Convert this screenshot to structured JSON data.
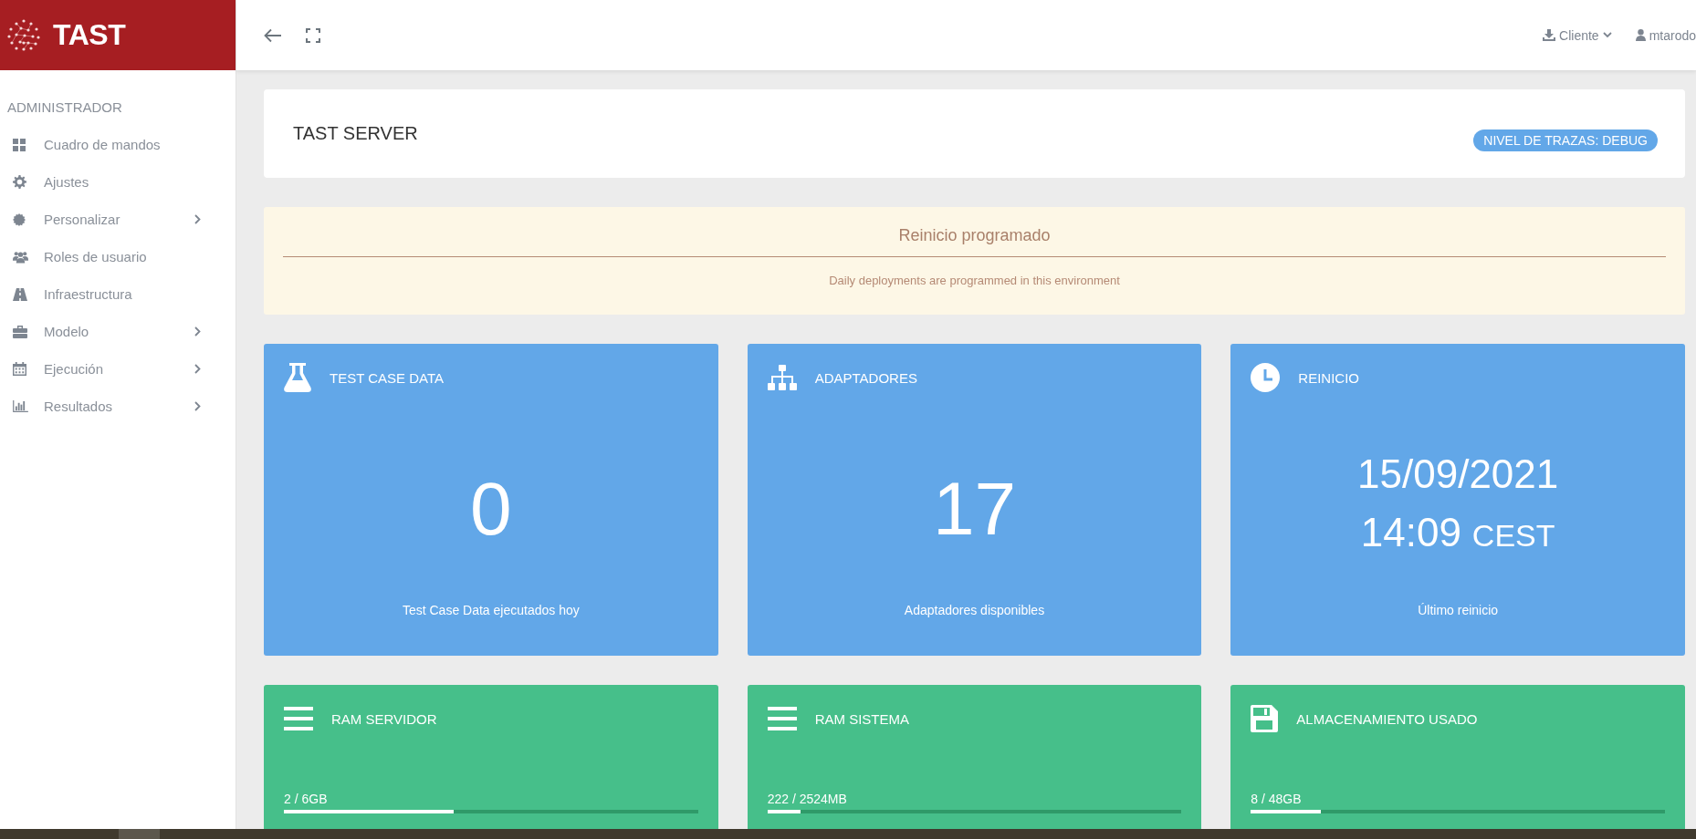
{
  "brand": {
    "name": "TAST"
  },
  "topbar": {
    "client_menu": "Cliente",
    "user_menu": "mtarodo"
  },
  "sidebar": {
    "section": "ADMINISTRADOR",
    "items": [
      {
        "label": "Cuadro de mandos",
        "expandable": false
      },
      {
        "label": "Ajustes",
        "expandable": false
      },
      {
        "label": "Personalizar",
        "expandable": true
      },
      {
        "label": "Roles de usuario",
        "expandable": false
      },
      {
        "label": "Infraestructura",
        "expandable": false
      },
      {
        "label": "Modelo",
        "expandable": true
      },
      {
        "label": "Ejecución",
        "expandable": true
      },
      {
        "label": "Resultados",
        "expandable": true
      }
    ]
  },
  "header": {
    "title": "TAST SERVER",
    "badge": "NIVEL DE TRAZAS: DEBUG"
  },
  "alert": {
    "title": "Reinicio programado",
    "message": "Daily deployments are programmed in this environment"
  },
  "stat_cards": [
    {
      "kind": "count",
      "title": "TEST CASE DATA",
      "value": "0",
      "caption": "Test Case Data ejecutados hoy"
    },
    {
      "kind": "count",
      "title": "ADAPTADORES",
      "value": "17",
      "caption": "Adaptadores disponibles"
    },
    {
      "kind": "datetime",
      "title": "REINICIO",
      "date": "15/09/2021",
      "time": "14:09",
      "zone": "CEST",
      "caption": "Último reinicio"
    }
  ],
  "usage_cards": [
    {
      "title": "RAM SERVIDOR",
      "reading": "2 / 6GB",
      "level": 0.41
    },
    {
      "title": "RAM SISTEMA",
      "reading": "222 / 2524MB",
      "level": 0.08
    },
    {
      "title": "ALMACENAMIENTO USADO",
      "reading": "8 / 48GB",
      "level": 0.17
    }
  ]
}
